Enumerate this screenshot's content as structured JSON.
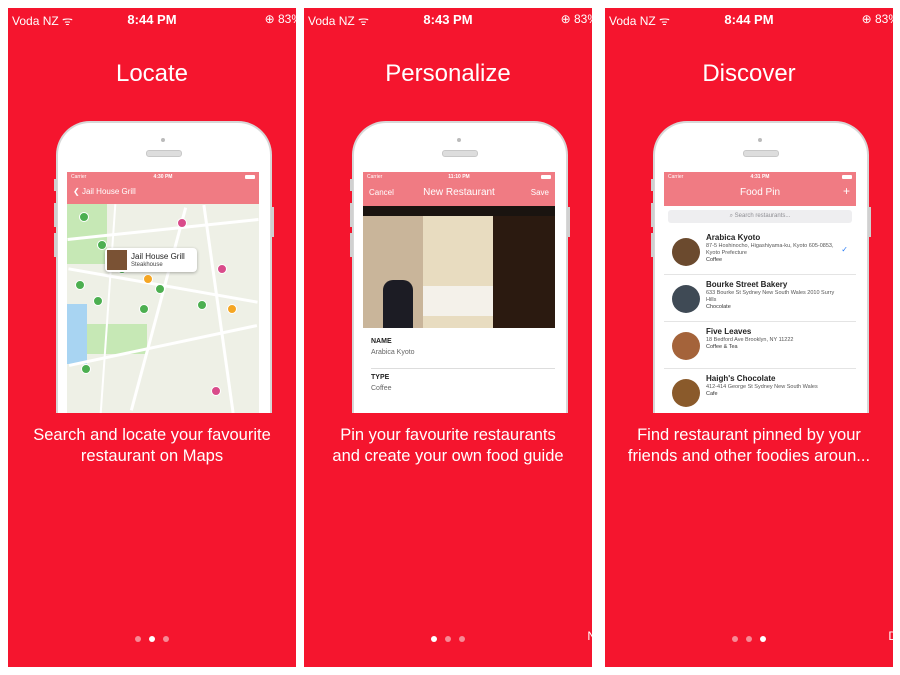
{
  "status_bars": [
    {
      "carrier": "Voda NZ",
      "time": "8:44 PM",
      "battery": "83%"
    },
    {
      "carrier": "Voda NZ",
      "time": "8:43 PM",
      "battery": "83%"
    },
    {
      "carrier": "Voda NZ",
      "time": "8:44 PM",
      "battery": "83%"
    }
  ],
  "panels": [
    {
      "title": "Locate",
      "description_line1": "Search and locate your favourite",
      "description_line2": "restaurant on Maps",
      "active_page": 1,
      "edge_char": ""
    },
    {
      "title": "Personalize",
      "description_line1": "Pin your favourite restaurants",
      "description_line2": "and create your own food guide",
      "active_page": 0,
      "edge_char": "N"
    },
    {
      "title": "Discover",
      "description_line1": "Find restaurant pinned by your",
      "description_line2": "friends and other foodies aroun...",
      "active_page": 2,
      "edge_char": "D"
    }
  ],
  "phone_status": {
    "carrier": "Carrier",
    "times": [
      "4:30 PM",
      "11:10 PM",
      "4:31 PM"
    ]
  },
  "map_screen": {
    "back_label": "Jail House Grill",
    "callout_name": "Jail House Grill",
    "callout_type": "Steakhouse"
  },
  "new_restaurant_screen": {
    "cancel": "Cancel",
    "title": "New Restaurant",
    "save": "Save",
    "fields": [
      {
        "label": "NAME",
        "value": "Arabica Kyoto"
      },
      {
        "label": "TYPE",
        "value": "Coffee"
      }
    ]
  },
  "food_pin_screen": {
    "title": "Food Pin",
    "add": "+",
    "search_placeholder": "Search restaurants...",
    "rows": [
      {
        "name": "Arabica Kyoto",
        "address": "87-5 Hoshinocho, Higashiyama-ku, Kyoto 605-0853, Kyoto Prefecture",
        "type": "Coffee",
        "checked": true
      },
      {
        "name": "Bourke Street Bakery",
        "address": "633 Bourke St Sydney New South Wales 2010 Surry Hills",
        "type": "Chocolate",
        "checked": false
      },
      {
        "name": "Five Leaves",
        "address": "18 Bedford Ave Brooklyn, NY 11222",
        "type": "Coffee & Tea",
        "checked": false
      },
      {
        "name": "Haigh's Chocolate",
        "address": "412-414 George St Sydney New South Wales",
        "type": "Cafe",
        "checked": false
      }
    ]
  },
  "colors": {
    "accent": "#f5152e",
    "navbar": "#f07b83",
    "dot_inactive": "#f78a95",
    "dot_active": "#ffffff"
  },
  "icons": [
    "wifi-icon",
    "alarm-icon",
    "back-chevron-icon",
    "checkmark-icon",
    "search-icon",
    "map-pin-icon"
  ]
}
